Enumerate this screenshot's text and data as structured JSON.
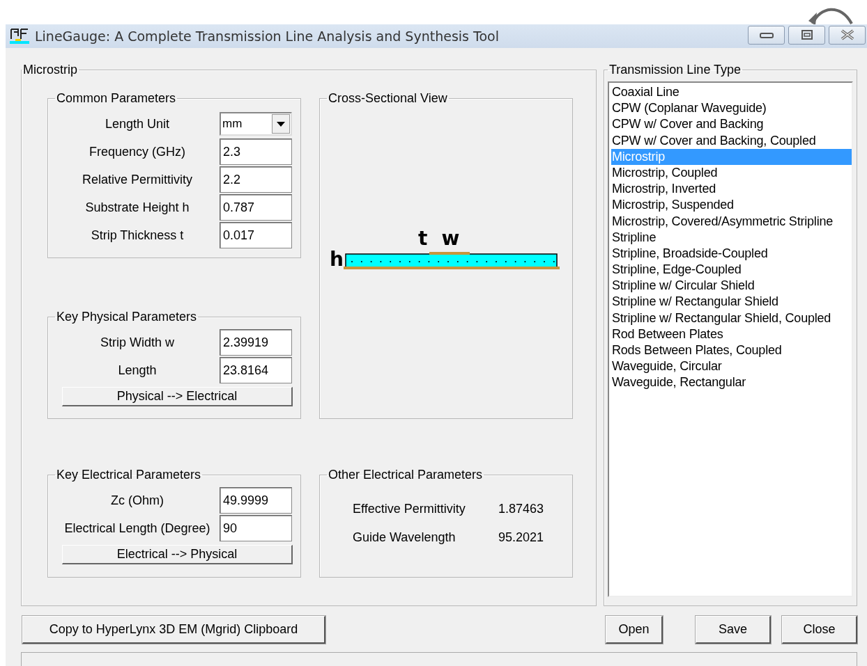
{
  "window": {
    "title": "LineGauge: A Complete Transmission Line Analysis and Synthesis Tool"
  },
  "microstrip": {
    "title": "Microstrip",
    "common": {
      "title": "Common Parameters",
      "fields": [
        {
          "label": "Length Unit",
          "value": "mm",
          "kind": "dropdown"
        },
        {
          "label": "Frequency (GHz)",
          "value": "2.3",
          "kind": "input"
        },
        {
          "label": "Relative Permittivity",
          "value": "2.2",
          "kind": "input"
        },
        {
          "label": "Substrate Height h",
          "value": "0.787",
          "kind": "input"
        },
        {
          "label": "Strip Thickness t",
          "value": "0.017",
          "kind": "input"
        }
      ]
    },
    "physical": {
      "title": "Key Physical Parameters",
      "fields": [
        {
          "label": "Strip Width w",
          "value": "2.39919"
        },
        {
          "label": "Length",
          "value": "23.8164"
        }
      ],
      "button": "Physical --> Electrical"
    },
    "electrical": {
      "title": "Key Electrical Parameters",
      "fields": [
        {
          "label": "Zc (Ohm)",
          "value": "49.9999"
        },
        {
          "label": "Electrical Length (Degree)",
          "value": "90"
        }
      ],
      "button": "Electrical --> Physical"
    },
    "cross_section": {
      "title": "Cross-Sectional View",
      "labels": {
        "t": "t",
        "w": "w",
        "h": "h"
      }
    },
    "other": {
      "title": "Other Electrical Parameters",
      "rows": [
        {
          "label": "Effective Permittivity",
          "value": "1.87463"
        },
        {
          "label": "Guide Wavelength",
          "value": "95.2021"
        }
      ]
    }
  },
  "line_type": {
    "title": "Transmission Line Type",
    "items": [
      {
        "label": "Coaxial Line",
        "selected": false
      },
      {
        "label": "CPW (Coplanar Waveguide)",
        "selected": false
      },
      {
        "label": "CPW w/ Cover and Backing",
        "selected": false
      },
      {
        "label": "CPW w/ Cover and Backing, Coupled",
        "selected": false
      },
      {
        "label": "Microstrip",
        "selected": true
      },
      {
        "label": "Microstrip, Coupled",
        "selected": false
      },
      {
        "label": "Microstrip, Inverted",
        "selected": false
      },
      {
        "label": "Microstrip, Suspended",
        "selected": false
      },
      {
        "label": "Microstrip, Covered/Asymmetric Stripline",
        "selected": false
      },
      {
        "label": "Stripline",
        "selected": false
      },
      {
        "label": "Stripline, Broadside-Coupled",
        "selected": false
      },
      {
        "label": "Stripline, Edge-Coupled",
        "selected": false
      },
      {
        "label": "Stripline w/ Circular Shield",
        "selected": false
      },
      {
        "label": "Stripline w/ Rectangular Shield",
        "selected": false
      },
      {
        "label": "Stripline w/ Rectangular Shield, Coupled",
        "selected": false
      },
      {
        "label": "Rod Between Plates",
        "selected": false
      },
      {
        "label": "Rods Between Plates, Coupled",
        "selected": false
      },
      {
        "label": "Waveguide, Circular",
        "selected": false
      },
      {
        "label": "Waveguide, Rectangular",
        "selected": false
      }
    ]
  },
  "buttons": {
    "copy": "Copy to HyperLynx 3D EM (Mgrid) Clipboard",
    "actions": [
      "Open",
      "Save",
      "Close"
    ]
  }
}
